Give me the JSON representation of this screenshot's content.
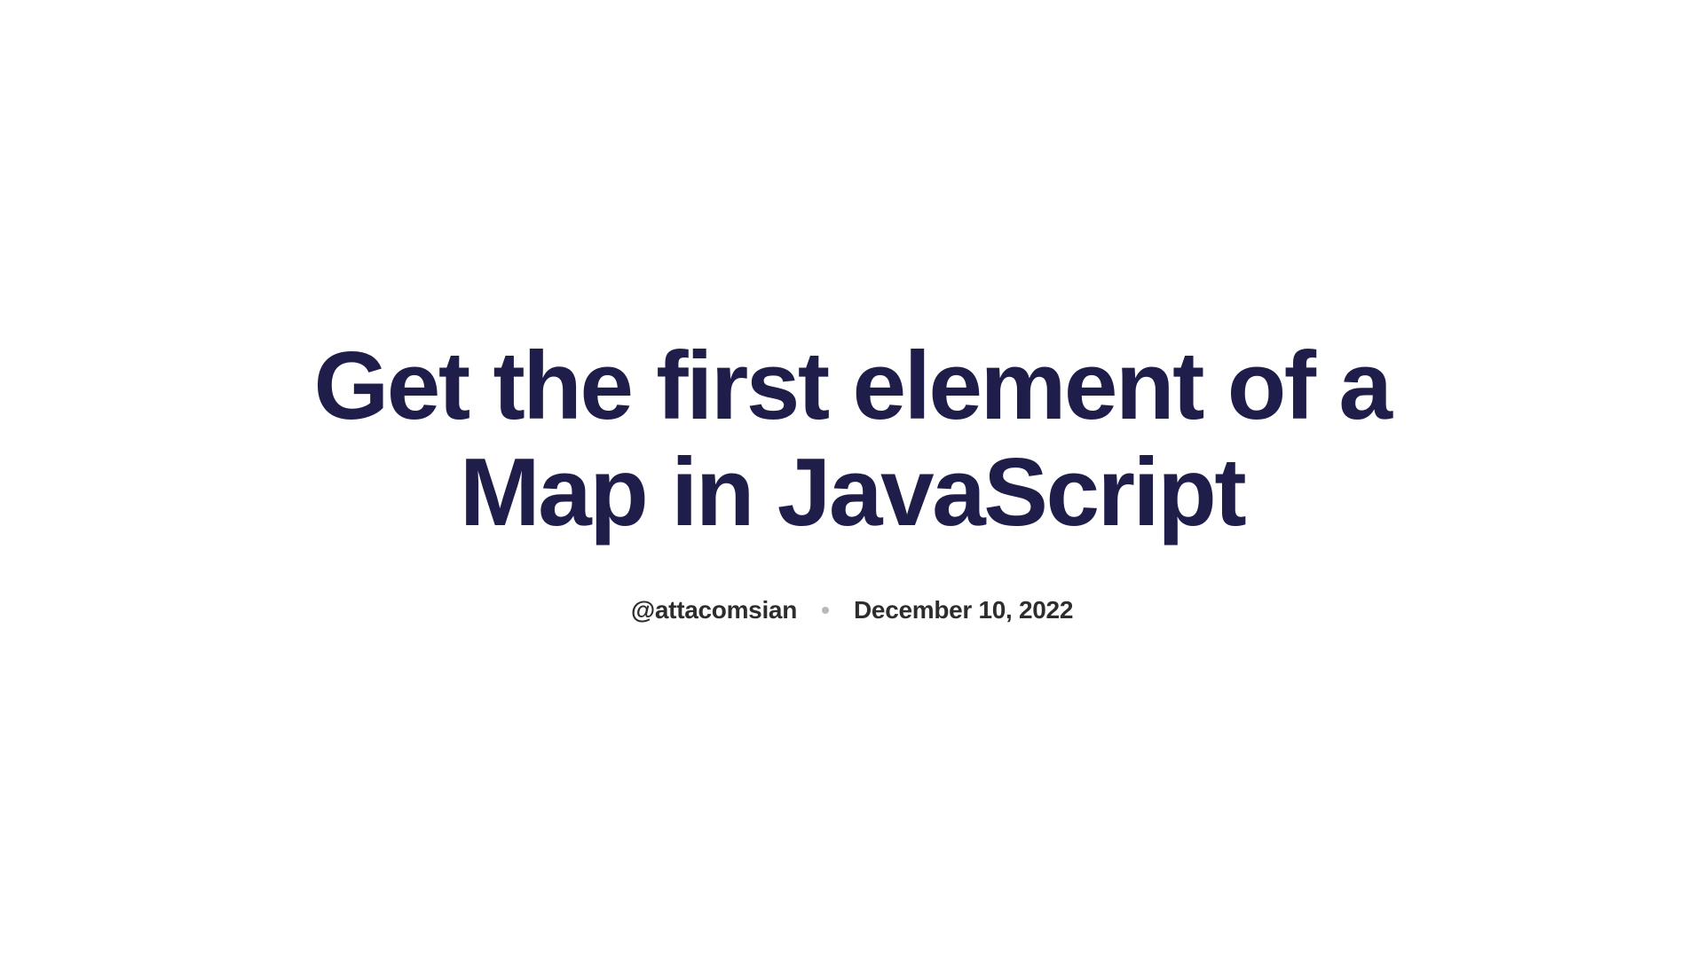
{
  "article": {
    "title": "Get the first element of a Map in JavaScript",
    "author": "@attacomsian",
    "date": "December 10, 2022"
  }
}
